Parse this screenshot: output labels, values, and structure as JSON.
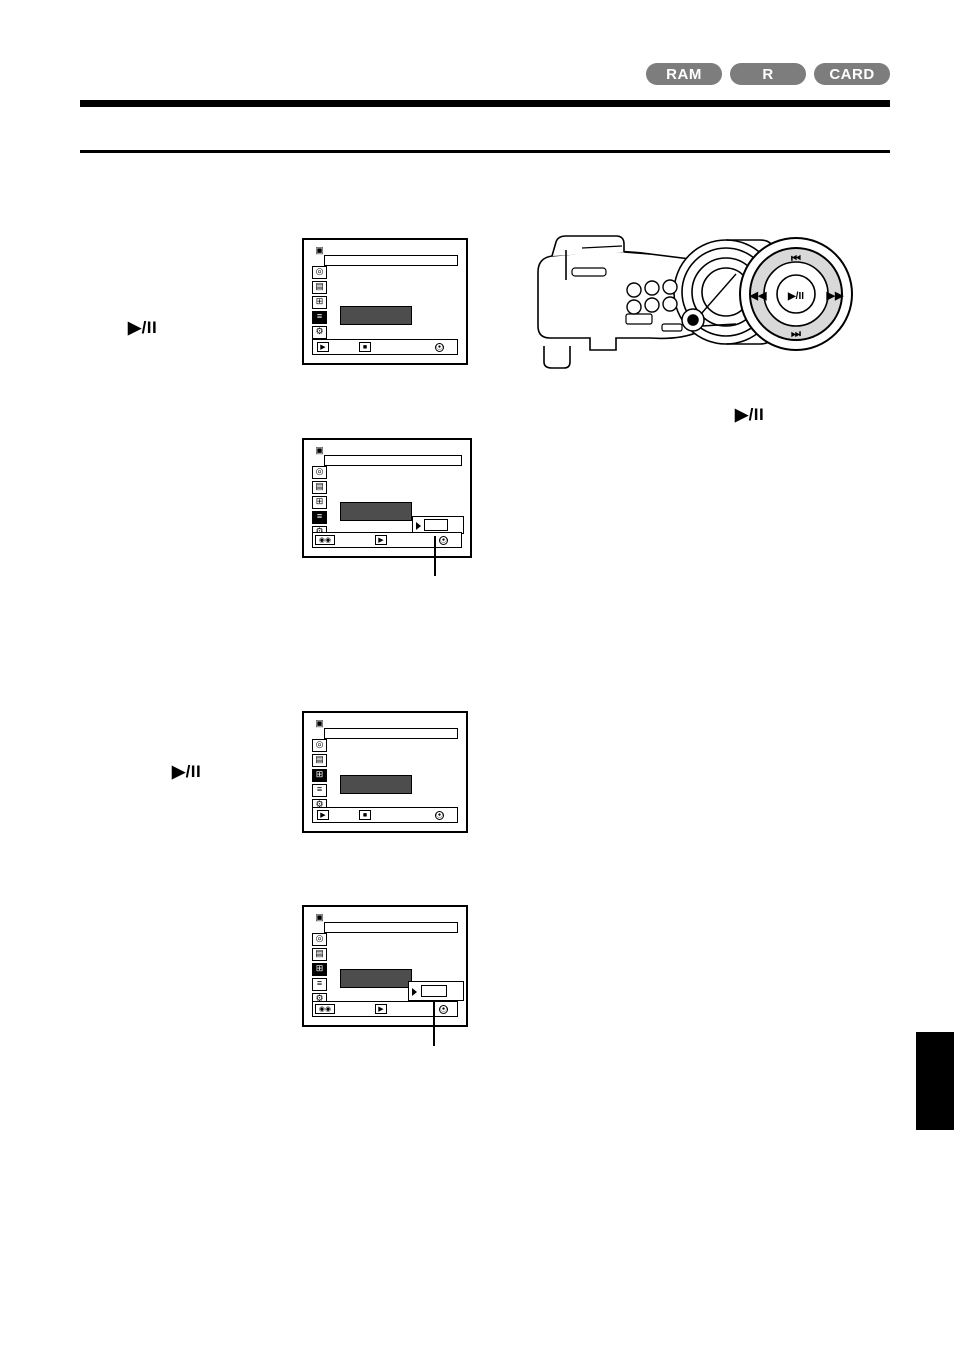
{
  "header": {
    "badges": [
      {
        "label": "RAM",
        "color": "#7d7d7d"
      },
      {
        "label": "R",
        "color": "#7d7d7d"
      },
      {
        "label": "CARD",
        "color": "#7d7d7d"
      }
    ]
  },
  "steps": [
    {
      "id": "step-1-play-pause",
      "label": "▶/II"
    },
    {
      "id": "step-2-play-pause",
      "label": "▶/II"
    }
  ],
  "callouts": [
    {
      "id": "callout-play-pause-button",
      "label": "▶/II"
    }
  ],
  "camcorder": {
    "name": "camcorder-illustration",
    "control_pad": {
      "name": "navigation-control-pad",
      "buttons": [
        {
          "name": "skip-back-button",
          "glyph": "⏮"
        },
        {
          "name": "rewind-button",
          "glyph": "◀◀"
        },
        {
          "name": "play-pause-button",
          "glyph": "▶/II"
        },
        {
          "name": "fast-forward-button",
          "glyph": "▶▶"
        },
        {
          "name": "skip-forward-button",
          "glyph": "⏭"
        }
      ]
    }
  },
  "lcd_screens": [
    {
      "id": "lcd-screen-1",
      "name": "lcd-menu-screen-1",
      "icon_column": [
        {
          "name": "camera-mode-icon",
          "glyph": "▣",
          "selected": false
        },
        {
          "name": "disc-icon",
          "glyph": "◎",
          "selected": false
        },
        {
          "name": "card-icon",
          "glyph": "▤",
          "selected": false
        },
        {
          "name": "grid-icon",
          "glyph": "⊞",
          "selected": false
        },
        {
          "name": "list-icon",
          "glyph": "≡",
          "selected": true
        },
        {
          "name": "settings-icon",
          "glyph": "⚙",
          "selected": false
        }
      ],
      "highlight_row": {
        "name": "menu-highlighted-row"
      },
      "bottom_bar": [
        {
          "name": "play-icon",
          "glyph": "▶"
        },
        {
          "name": "stop-icon",
          "glyph": "■"
        },
        {
          "name": "exit-icon",
          "glyph": "⦿"
        }
      ]
    },
    {
      "id": "lcd-screen-2",
      "name": "lcd-menu-screen-2",
      "icon_column": [
        {
          "name": "camera-mode-icon",
          "glyph": "▣",
          "selected": false
        },
        {
          "name": "disc-icon",
          "glyph": "◎",
          "selected": false
        },
        {
          "name": "card-icon",
          "glyph": "▤",
          "selected": false
        },
        {
          "name": "grid-icon",
          "glyph": "⊞",
          "selected": false
        },
        {
          "name": "list-icon",
          "glyph": "≡",
          "selected": true
        },
        {
          "name": "settings-icon",
          "glyph": "⚙",
          "selected": false
        }
      ],
      "highlight_row": {
        "name": "menu-highlighted-row"
      },
      "submenu": {
        "name": "submenu-popup"
      },
      "bottom_bar": [
        {
          "name": "dual-select-icon",
          "glyph": "◉◉"
        },
        {
          "name": "play-icon",
          "glyph": "▶"
        },
        {
          "name": "exit-icon",
          "glyph": "⦿"
        }
      ]
    },
    {
      "id": "lcd-screen-3",
      "name": "lcd-menu-screen-3",
      "icon_column": [
        {
          "name": "camera-mode-icon",
          "glyph": "▣",
          "selected": false
        },
        {
          "name": "disc-icon",
          "glyph": "◎",
          "selected": false
        },
        {
          "name": "card-icon",
          "glyph": "▤",
          "selected": false
        },
        {
          "name": "grid-icon",
          "glyph": "⊞",
          "selected": true
        },
        {
          "name": "list-icon",
          "glyph": "≡",
          "selected": false
        },
        {
          "name": "settings-icon",
          "glyph": "⚙",
          "selected": false
        }
      ],
      "highlight_row": {
        "name": "menu-highlighted-row"
      },
      "bottom_bar": [
        {
          "name": "play-icon",
          "glyph": "▶"
        },
        {
          "name": "stop-icon",
          "glyph": "■"
        },
        {
          "name": "exit-icon",
          "glyph": "⦿"
        }
      ]
    },
    {
      "id": "lcd-screen-4",
      "name": "lcd-menu-screen-4",
      "icon_column": [
        {
          "name": "camera-mode-icon",
          "glyph": "▣",
          "selected": false
        },
        {
          "name": "disc-icon",
          "glyph": "◎",
          "selected": false
        },
        {
          "name": "card-icon",
          "glyph": "▤",
          "selected": false
        },
        {
          "name": "grid-icon",
          "glyph": "⊞",
          "selected": true
        },
        {
          "name": "list-icon",
          "glyph": "≡",
          "selected": false
        },
        {
          "name": "settings-icon",
          "glyph": "⚙",
          "selected": false
        }
      ],
      "highlight_row": {
        "name": "menu-highlighted-row"
      },
      "submenu": {
        "name": "submenu-popup"
      },
      "bottom_bar": [
        {
          "name": "dual-select-icon",
          "glyph": "◉◉"
        },
        {
          "name": "play-icon",
          "glyph": "▶"
        },
        {
          "name": "exit-icon",
          "glyph": "⦿"
        }
      ]
    }
  ]
}
